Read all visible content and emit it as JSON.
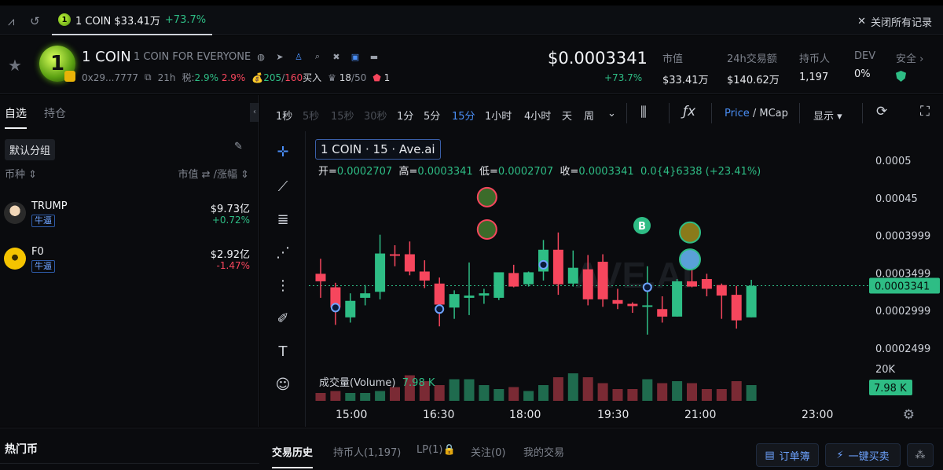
{
  "tabbar": {
    "active_tab": {
      "label": "1 COIN $33.41万",
      "change": "+73.7%"
    },
    "close_all": "关闭所有记录"
  },
  "token": {
    "logo_text": "1",
    "name": "1 COIN",
    "subtitle": "1 COIN FOR EVERYONE",
    "address": "0x29...7777",
    "age": "21h",
    "tax_label": "税:",
    "tax_buy": "2.9%",
    "tax_sell": "2.9%",
    "buys": "205",
    "sells": "160",
    "buy_label": "买入",
    "holders_a": "18",
    "holders_b": "50",
    "flag_count": "1",
    "price": "$0.0003341",
    "price_change": "+73.7%"
  },
  "stats": [
    {
      "label": "市值",
      "value": "$33.41万"
    },
    {
      "label": "24h交易额",
      "value": "$140.62万"
    },
    {
      "label": "持币人",
      "value": "1,197"
    },
    {
      "label": "DEV",
      "value": "0%"
    },
    {
      "label": "安全",
      "value": ""
    }
  ],
  "watchlist": {
    "tabs": [
      "自选",
      "持仓"
    ],
    "group": "默认分组",
    "col_coin": "币种 ⇕",
    "col_mc": "市值 ⇄ /涨幅 ⇕",
    "items": [
      {
        "symbol": "TRUMP",
        "tag": "牛逼",
        "market_cap": "$9.73亿",
        "change": "+0.72%",
        "change_color": "#2ebd85"
      },
      {
        "symbol": "F0",
        "tag": "牛逼",
        "market_cap": "$2.92亿",
        "change": "-1.47%",
        "change_color": "#f6465d"
      }
    ]
  },
  "chart_toolbar": {
    "timeframes": [
      {
        "label": "1秒",
        "state": "normal"
      },
      {
        "label": "5秒",
        "state": "dim"
      },
      {
        "label": "15秒",
        "state": "dim"
      },
      {
        "label": "30秒",
        "state": "dim"
      },
      {
        "label": "1分",
        "state": "normal"
      },
      {
        "label": "5分",
        "state": "normal"
      },
      {
        "label": "15分",
        "state": "active"
      },
      {
        "label": "1小时",
        "state": "normal"
      },
      {
        "label": "4小时",
        "state": "normal"
      },
      {
        "label": "天",
        "state": "normal"
      },
      {
        "label": "周",
        "state": "normal"
      }
    ],
    "price_toggle_a": "Price",
    "price_toggle_sep": " / ",
    "price_toggle_b": "MCap",
    "display": "显示"
  },
  "chart_data": {
    "type": "candlestick",
    "title": "1 COIN · 15 · Ave.ai",
    "ohlc_labels": {
      "open": "开=",
      "high": "高=",
      "low": "低=",
      "close": "收="
    },
    "ohlc": {
      "open": "0.0002707",
      "high": "0.0003341",
      "low": "0.0002707",
      "close": "0.0003341",
      "change": "0.0{4}6338 (+23.41%)"
    },
    "watermark": "AVE.AI",
    "y_ticks": [
      "0.0005",
      "0.00045",
      "0.0003999",
      "0.0003499",
      "0.0002999",
      "0.0002499"
    ],
    "current_price": "0.0003341",
    "x_ticks": [
      "15:00",
      "16:30",
      "18:00",
      "19:30",
      "21:00",
      "23:00"
    ],
    "volume_label": "成交量(Volume)",
    "volume_value": "7.98 K",
    "volume_axis_label": "20K",
    "volume_badge": "7.98 K",
    "marker_b": "B",
    "candles": [
      {
        "o": 0.00035,
        "h": 0.00037,
        "l": 0.000318,
        "c": 0.00034
      },
      {
        "o": 0.000332,
        "h": 0.000338,
        "l": 0.000282,
        "c": 0.000305
      },
      {
        "o": 0.000292,
        "h": 0.000324,
        "l": 0.000285,
        "c": 0.000314
      },
      {
        "o": 0.000318,
        "h": 0.000335,
        "l": 0.000308,
        "c": 0.000324
      },
      {
        "o": 0.000326,
        "h": 0.000402,
        "l": 0.000316,
        "c": 0.000377
      },
      {
        "o": 0.000376,
        "h": 0.000388,
        "l": 0.00036,
        "c": 0.000374
      },
      {
        "o": 0.000376,
        "h": 0.000393,
        "l": 0.000348,
        "c": 0.000353
      },
      {
        "o": 0.000353,
        "h": 0.000368,
        "l": 0.000331,
        "c": 0.000341
      },
      {
        "o": 0.000337,
        "h": 0.000345,
        "l": 0.00028,
        "c": 0.000309
      },
      {
        "o": 0.000305,
        "h": 0.000328,
        "l": 0.00029,
        "c": 0.000323
      },
      {
        "o": 0.000318,
        "h": 0.000365,
        "l": 0.000295,
        "c": 0.000321
      },
      {
        "o": 0.000321,
        "h": 0.00033,
        "l": 0.00031,
        "c": 0.000324
      },
      {
        "o": 0.000318,
        "h": 0.000348,
        "l": 0.000315,
        "c": 0.000352
      },
      {
        "o": 0.000351,
        "h": 0.000362,
        "l": 0.000332,
        "c": 0.000333
      },
      {
        "o": 0.000336,
        "h": 0.000353,
        "l": 0.000333,
        "c": 0.000352
      },
      {
        "o": 0.000353,
        "h": 0.000395,
        "l": 0.000341,
        "c": 0.000382
      },
      {
        "o": 0.000382,
        "h": 0.000405,
        "l": 0.000322,
        "c": 0.000336
      },
      {
        "o": 0.000337,
        "h": 0.000381,
        "l": 0.000333,
        "c": 0.000358
      },
      {
        "o": 0.000356,
        "h": 0.000375,
        "l": 0.000308,
        "c": 0.000316
      },
      {
        "o": 0.000366,
        "h": 0.000376,
        "l": 0.000306,
        "c": 0.000316
      },
      {
        "o": 0.000315,
        "h": 0.00033,
        "l": 0.000303,
        "c": 0.00031
      },
      {
        "o": 0.00031,
        "h": 0.000312,
        "l": 0.000298,
        "c": 0.000307
      },
      {
        "o": 0.000308,
        "h": 0.00036,
        "l": 0.000269,
        "c": 0.000308
      },
      {
        "o": 0.000303,
        "h": 0.00032,
        "l": 0.000285,
        "c": 0.000293
      },
      {
        "o": 0.000293,
        "h": 0.000343,
        "l": 0.000293,
        "c": 0.00034
      },
      {
        "o": 0.00034,
        "h": 0.000378,
        "l": 0.000332,
        "c": 0.000333
      },
      {
        "o": 0.000343,
        "h": 0.00035,
        "l": 0.00032,
        "c": 0.00033
      },
      {
        "o": 0.000335,
        "h": 0.000337,
        "l": 0.00029,
        "c": 0.000321
      },
      {
        "o": 0.000322,
        "h": 0.000334,
        "l": 0.000277,
        "c": 0.000288
      },
      {
        "o": 0.000292,
        "h": 0.000342,
        "l": 0.000292,
        "c": 0.000334
      }
    ],
    "volumes": [
      4,
      5,
      4,
      4,
      5,
      7,
      13,
      10,
      8,
      11,
      11,
      8,
      6,
      7,
      5,
      8,
      12,
      14,
      12,
      9,
      6,
      6,
      11,
      9,
      10,
      9,
      6,
      6,
      10,
      8
    ]
  },
  "bottom": {
    "hot": "热门币",
    "tabs": [
      "交易历史",
      "持币人(1,197)",
      "LP(1)🔒",
      "关注(0)",
      "我的交易"
    ],
    "order_book": "订单簿",
    "one_click": "一键买卖"
  },
  "colors": {
    "up": "#2ebd85",
    "down": "#f6465d",
    "accent": "#4a8ef5"
  }
}
